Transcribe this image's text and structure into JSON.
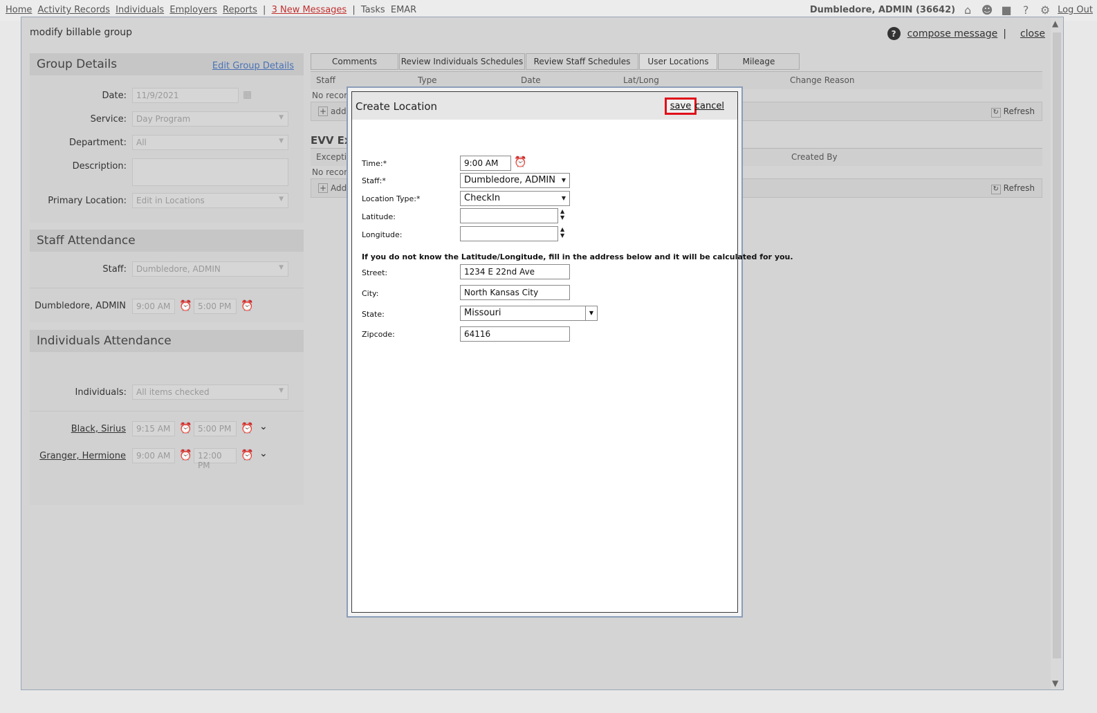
{
  "topnav": {
    "links": [
      "Home",
      "Activity Records",
      "Individuals",
      "Employers",
      "Reports"
    ],
    "messages": "3 New Messages",
    "tasks": "Tasks",
    "emar": "EMAR",
    "user": "Dumbledore, ADMIN (36642)",
    "logout": "Log Out"
  },
  "modal": {
    "title": "modify billable group",
    "help": "?",
    "compose": "compose message",
    "separator": "|",
    "close": "close"
  },
  "group_details": {
    "title": "Group Details",
    "edit_link": "Edit Group Details",
    "fields": [
      {
        "label": "Date:",
        "value": "11/9/2021"
      },
      {
        "label": "Service:",
        "value": "Day Program"
      },
      {
        "label": "Department:",
        "value": "All"
      },
      {
        "label": "Description:",
        "value": ""
      },
      {
        "label": "Primary Location:",
        "value": "Edit in Locations"
      }
    ]
  },
  "staff_attendance": {
    "title": "Staff Attendance",
    "staff_label": "Staff:",
    "staff_value": "Dumbledore, ADMIN",
    "row": {
      "name": "Dumbledore, ADMIN",
      "in": "9:00 AM",
      "out": "5:00 PM"
    }
  },
  "individuals_attendance": {
    "title": "Individuals Attendance",
    "label": "Individuals:",
    "value": "All items checked",
    "rows": [
      {
        "name": "Black, Sirius",
        "in": "9:15 AM",
        "out": "5:00 PM"
      },
      {
        "name": "Granger, Hermione",
        "in": "9:00 AM",
        "out": "12:00 PM"
      }
    ]
  },
  "tabs": [
    "Comments",
    "Review Individuals Schedules",
    "Review Staff Schedules",
    "User Locations",
    "Mileage"
  ],
  "locations_grid": {
    "columns": [
      "Staff",
      "Type",
      "Date",
      "Lat/Long",
      "Change Reason"
    ],
    "empty": "No record",
    "add": "add",
    "refresh": "Refresh"
  },
  "evv_section": {
    "title": "EVV Exc",
    "columns": [
      "Exception",
      "Created By"
    ],
    "empty": "No record",
    "add": "Add",
    "refresh": "Refresh"
  },
  "dialog": {
    "title": "Create Location",
    "save": "save",
    "cancel": "cancel",
    "time_label": "Time:*",
    "time_value": "9:00 AM",
    "staff_label": "Staff:*",
    "staff_value": "Dumbledore, ADMIN",
    "type_label": "Location Type:*",
    "type_value": "CheckIn",
    "lat_label": "Latitude:",
    "lat_value": "",
    "lon_label": "Longitude:",
    "lon_value": "",
    "note": "If you do not know the Latitude/Longitude, fill in the address below and it will be calculated for you.",
    "street_label": "Street:",
    "street_value": "1234 E 22nd Ave",
    "city_label": "City:",
    "city_value": "North Kansas City",
    "state_label": "State:",
    "state_value": "Missouri",
    "zip_label": "Zipcode:",
    "zip_value": "64116"
  }
}
